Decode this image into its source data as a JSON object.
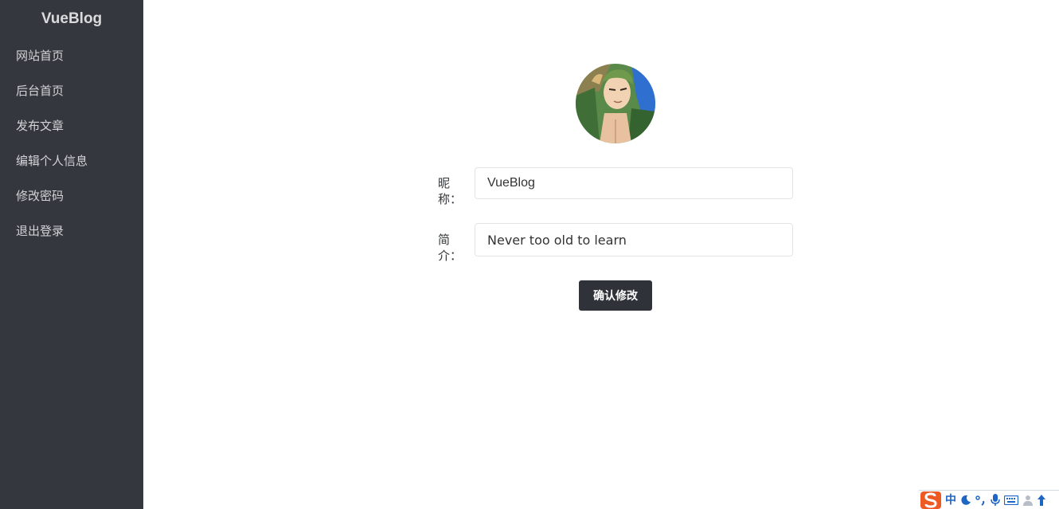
{
  "sidebar": {
    "brand": "VueBlog",
    "items": [
      {
        "label": "网站首页"
      },
      {
        "label": "后台首页"
      },
      {
        "label": "发布文章"
      },
      {
        "label": "编辑个人信息"
      },
      {
        "label": "修改密码"
      },
      {
        "label": "退出登录"
      }
    ]
  },
  "profile_form": {
    "nickname_label": "昵称：",
    "nickname_value": "VueBlog",
    "intro_label": "简介：",
    "intro_value": "Never too old to learn",
    "submit_label": "确认修改"
  },
  "ime_toolbar": {
    "language": "中",
    "icons": [
      "sogou-logo-icon",
      "moon-icon",
      "punctuation-icon",
      "microphone-icon",
      "keyboard-icon",
      "user-icon",
      "upload-icon"
    ]
  },
  "colors": {
    "sidebar_bg": "#34373e",
    "button_bg": "#2f3238",
    "ime_blue": "#1e66c4",
    "ime_orange": "#ee5a24"
  }
}
